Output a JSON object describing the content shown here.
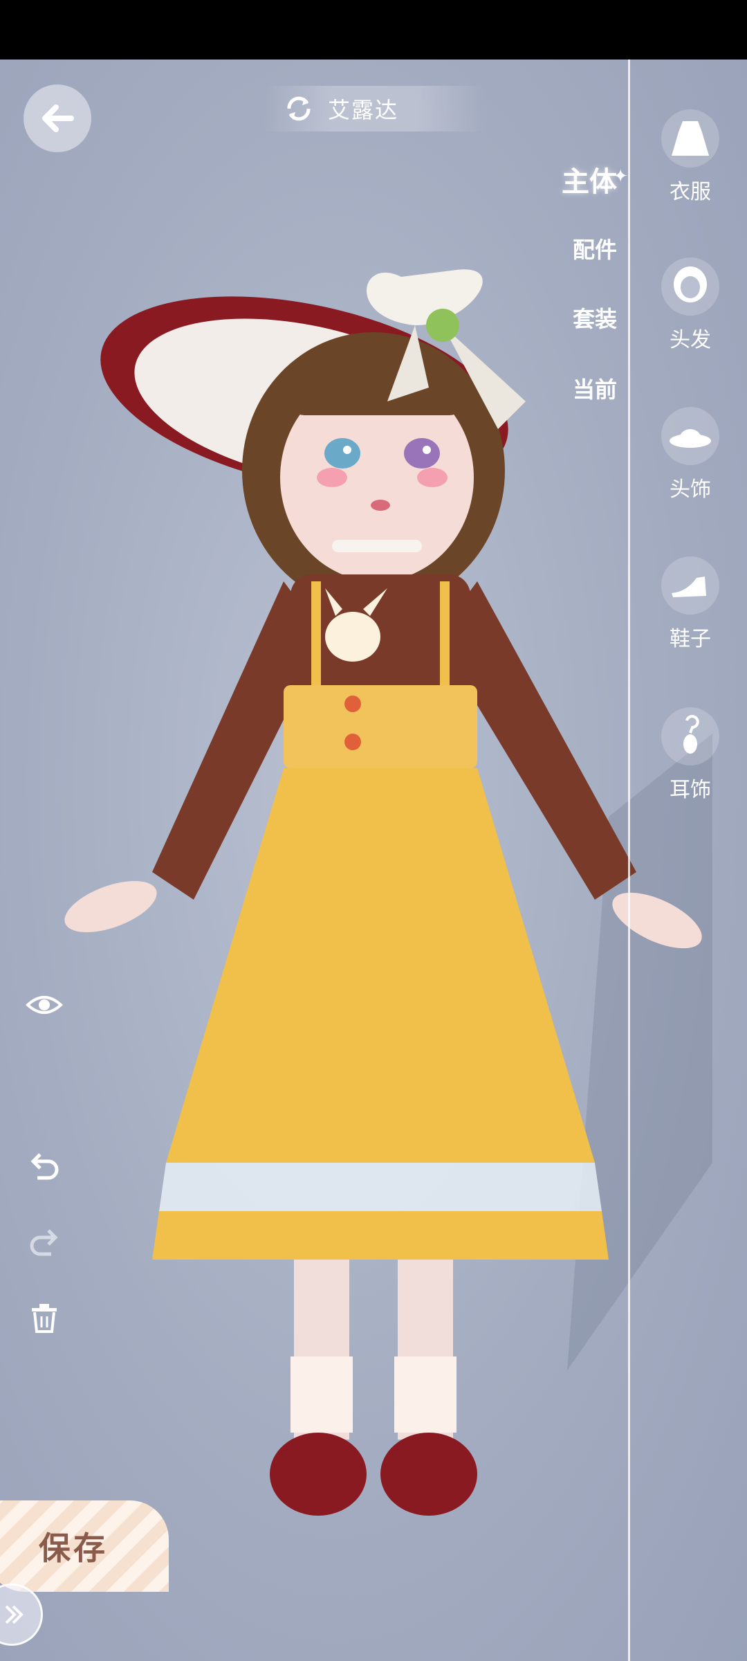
{
  "header": {
    "character_name": "艾露达"
  },
  "subtabs": [
    "主体",
    "配件",
    "套装",
    "当前"
  ],
  "categories": [
    {
      "label": "衣服",
      "icon": "dress-icon"
    },
    {
      "label": "头发",
      "icon": "hair-icon"
    },
    {
      "label": "头饰",
      "icon": "hat-icon"
    },
    {
      "label": "鞋子",
      "icon": "shoe-icon"
    },
    {
      "label": "耳饰",
      "icon": "earring-icon"
    }
  ],
  "actions": {
    "save_label": "保存"
  },
  "colors": {
    "dress_yellow": "#f0c04a",
    "top_brown": "#7a3a2a",
    "hat_red": "#8a1a22",
    "accent_white": "#ffffff"
  }
}
